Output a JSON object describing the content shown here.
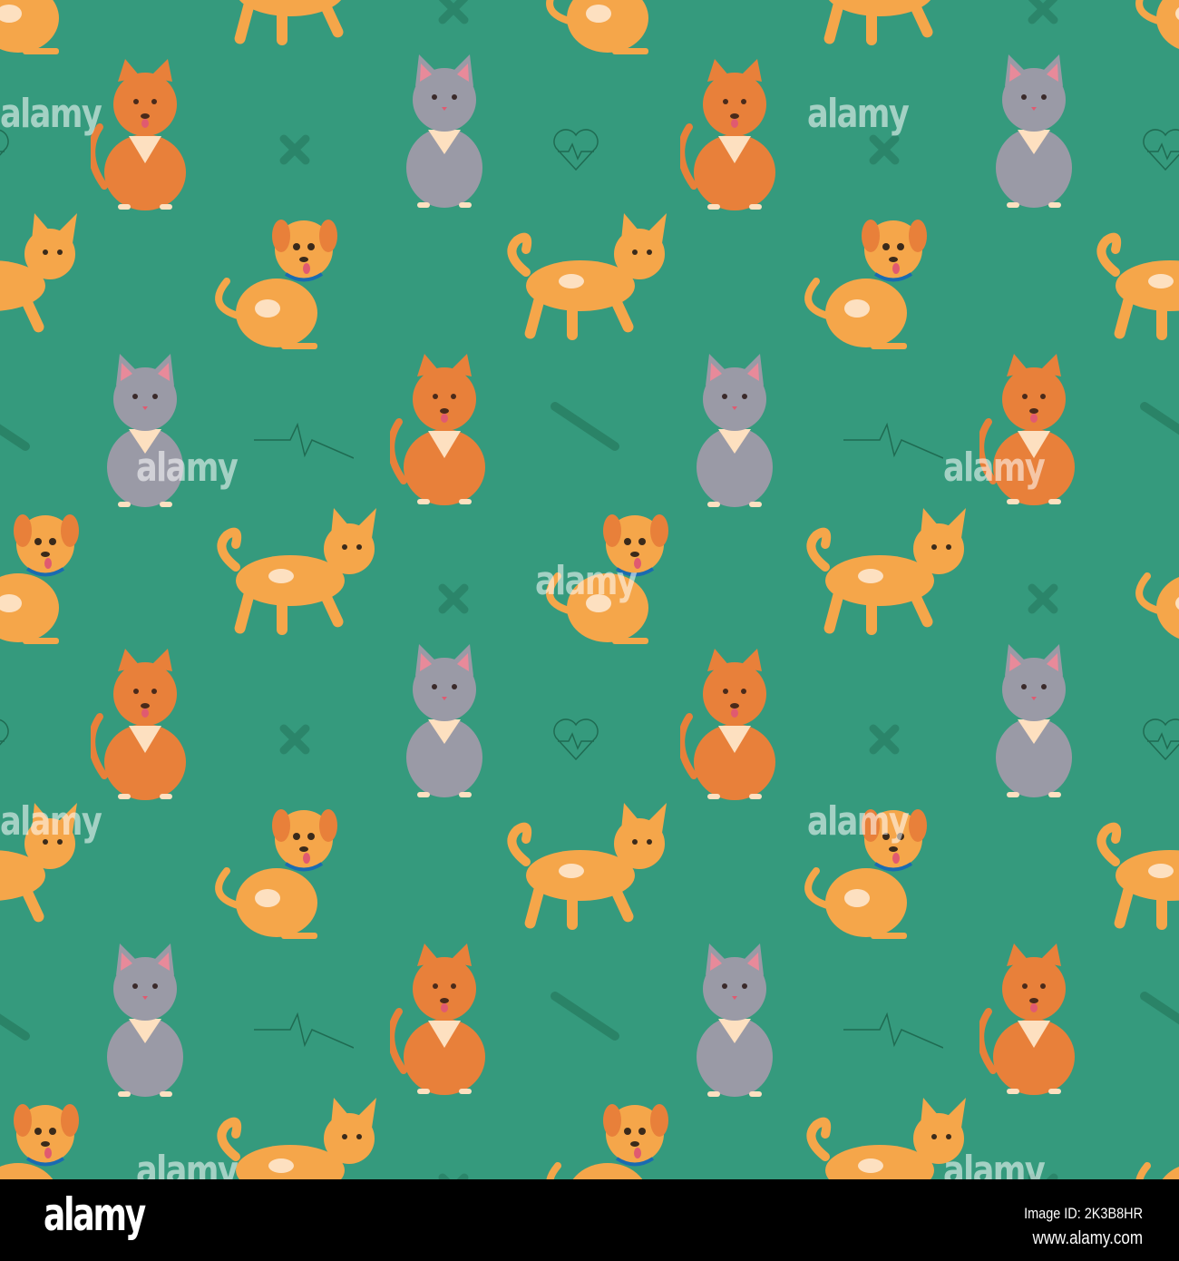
{
  "colors": {
    "background": "#359a7d",
    "orange": "#f39a3c",
    "brown_orange": "#e8803a",
    "grey": "#9a9aa6",
    "cream": "#fde0c0",
    "doodle": "#1f6b52"
  },
  "watermark": "alamy",
  "footer": {
    "logo": "alamy",
    "image_id": "Image ID: 2K3B8HR",
    "url": "www.alamy.com"
  }
}
